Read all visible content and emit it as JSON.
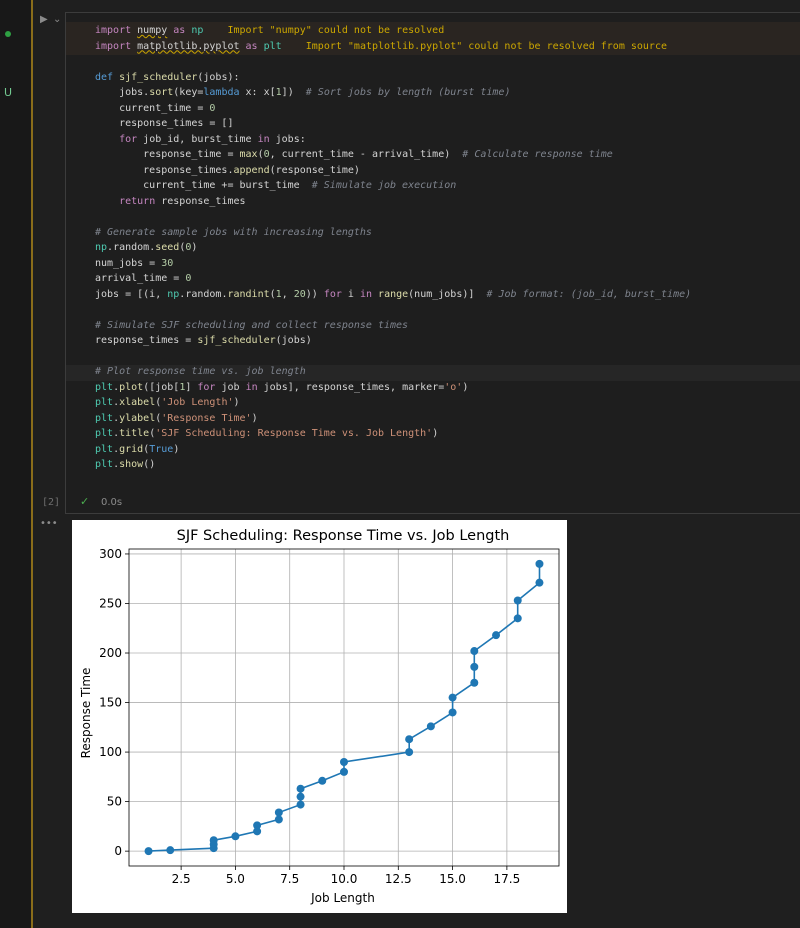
{
  "editor": {
    "exec_count": "[2]",
    "duration": "0.0s",
    "status_mark": "U",
    "more_label": "•••",
    "code_lines": [
      [
        {
          "t": "import ",
          "c": "kw"
        },
        {
          "t": "numpy",
          "c": "squig"
        },
        {
          "t": " as ",
          "c": "kw"
        },
        {
          "t": "np",
          "c": "cls"
        },
        {
          "t": "    Import \"numpy\" could not be resolved",
          "c": "warn"
        }
      ],
      [
        {
          "t": "import ",
          "c": "kw"
        },
        {
          "t": "matplotlib.pyplot",
          "c": "squig"
        },
        {
          "t": " as ",
          "c": "kw"
        },
        {
          "t": "plt",
          "c": "cls"
        },
        {
          "t": "    Import \"matplotlib.pyplot\" could not be resolved from source",
          "c": "warn"
        }
      ],
      [],
      [
        {
          "t": "def ",
          "c": "kw2"
        },
        {
          "t": "sjf_scheduler",
          "c": "fn"
        },
        {
          "t": "(jobs):",
          "c": ""
        }
      ],
      [
        {
          "t": "    jobs.",
          "c": ""
        },
        {
          "t": "sort",
          "c": "fn"
        },
        {
          "t": "(key=",
          "c": ""
        },
        {
          "t": "lambda",
          "c": "kw2"
        },
        {
          "t": " x: x[",
          "c": ""
        },
        {
          "t": "1",
          "c": "num"
        },
        {
          "t": "])  ",
          "c": ""
        },
        {
          "t": "# Sort jobs by length (burst time)",
          "c": "cm"
        }
      ],
      [
        {
          "t": "    current_time = ",
          "c": ""
        },
        {
          "t": "0",
          "c": "num"
        }
      ],
      [
        {
          "t": "    response_times = []",
          "c": ""
        }
      ],
      [
        {
          "t": "    ",
          "c": ""
        },
        {
          "t": "for",
          "c": "kw"
        },
        {
          "t": " job_id, burst_time ",
          "c": ""
        },
        {
          "t": "in",
          "c": "kw"
        },
        {
          "t": " jobs:",
          "c": ""
        }
      ],
      [
        {
          "t": "        response_time = ",
          "c": ""
        },
        {
          "t": "max",
          "c": "fn"
        },
        {
          "t": "(",
          "c": ""
        },
        {
          "t": "0",
          "c": "num"
        },
        {
          "t": ", current_time - arrival_time)  ",
          "c": ""
        },
        {
          "t": "# Calculate response time",
          "c": "cm"
        }
      ],
      [
        {
          "t": "        response_times.",
          "c": ""
        },
        {
          "t": "append",
          "c": "fn"
        },
        {
          "t": "(response_time)",
          "c": ""
        }
      ],
      [
        {
          "t": "        current_time += burst_time  ",
          "c": ""
        },
        {
          "t": "# Simulate job execution",
          "c": "cm"
        }
      ],
      [
        {
          "t": "    ",
          "c": ""
        },
        {
          "t": "return",
          "c": "kw"
        },
        {
          "t": " response_times",
          "c": ""
        }
      ],
      [],
      [
        {
          "t": "# Generate sample jobs with increasing lengths",
          "c": "cm"
        }
      ],
      [
        {
          "t": "np",
          "c": "cls"
        },
        {
          "t": ".random.",
          "c": ""
        },
        {
          "t": "seed",
          "c": "fn"
        },
        {
          "t": "(",
          "c": ""
        },
        {
          "t": "0",
          "c": "num"
        },
        {
          "t": ")",
          "c": ""
        }
      ],
      [
        {
          "t": "num_jobs = ",
          "c": ""
        },
        {
          "t": "30",
          "c": "num"
        }
      ],
      [
        {
          "t": "arrival_time = ",
          "c": ""
        },
        {
          "t": "0",
          "c": "num"
        }
      ],
      [
        {
          "t": "jobs = [(i, ",
          "c": ""
        },
        {
          "t": "np",
          "c": "cls"
        },
        {
          "t": ".random.",
          "c": ""
        },
        {
          "t": "randint",
          "c": "fn"
        },
        {
          "t": "(",
          "c": ""
        },
        {
          "t": "1",
          "c": "num"
        },
        {
          "t": ", ",
          "c": ""
        },
        {
          "t": "20",
          "c": "num"
        },
        {
          "t": ")) ",
          "c": ""
        },
        {
          "t": "for",
          "c": "kw"
        },
        {
          "t": " i ",
          "c": ""
        },
        {
          "t": "in",
          "c": "kw"
        },
        {
          "t": " ",
          "c": ""
        },
        {
          "t": "range",
          "c": "fn"
        },
        {
          "t": "(num_jobs)]  ",
          "c": ""
        },
        {
          "t": "# Job format: (job_id, burst_time)",
          "c": "cm"
        }
      ],
      [],
      [
        {
          "t": "# Simulate SJF scheduling and collect response times",
          "c": "cm"
        }
      ],
      [
        {
          "t": "response_times = ",
          "c": ""
        },
        {
          "t": "sjf_scheduler",
          "c": "fn"
        },
        {
          "t": "(jobs)",
          "c": ""
        }
      ],
      [],
      [
        {
          "t": "# Plot response time vs. job length",
          "c": "cm"
        }
      ],
      [
        {
          "t": "plt",
          "c": "cls"
        },
        {
          "t": ".",
          "c": ""
        },
        {
          "t": "plot",
          "c": "fn"
        },
        {
          "t": "([job[",
          "c": ""
        },
        {
          "t": "1",
          "c": "num"
        },
        {
          "t": "] ",
          "c": ""
        },
        {
          "t": "for",
          "c": "kw"
        },
        {
          "t": " job ",
          "c": ""
        },
        {
          "t": "in",
          "c": "kw"
        },
        {
          "t": " jobs], response_times, marker=",
          "c": ""
        },
        {
          "t": "'o'",
          "c": "str"
        },
        {
          "t": ")",
          "c": ""
        }
      ],
      [
        {
          "t": "plt",
          "c": "cls"
        },
        {
          "t": ".",
          "c": ""
        },
        {
          "t": "xlabel",
          "c": "fn"
        },
        {
          "t": "(",
          "c": ""
        },
        {
          "t": "'Job Length'",
          "c": "str"
        },
        {
          "t": ")",
          "c": ""
        }
      ],
      [
        {
          "t": "plt",
          "c": "cls"
        },
        {
          "t": ".",
          "c": ""
        },
        {
          "t": "ylabel",
          "c": "fn"
        },
        {
          "t": "(",
          "c": ""
        },
        {
          "t": "'Response Time'",
          "c": "str"
        },
        {
          "t": ")",
          "c": ""
        }
      ],
      [
        {
          "t": "plt",
          "c": "cls"
        },
        {
          "t": ".",
          "c": ""
        },
        {
          "t": "title",
          "c": "fn"
        },
        {
          "t": "(",
          "c": ""
        },
        {
          "t": "'SJF Scheduling: Response Time vs. Job Length'",
          "c": "str"
        },
        {
          "t": ")",
          "c": ""
        }
      ],
      [
        {
          "t": "plt",
          "c": "cls"
        },
        {
          "t": ".",
          "c": ""
        },
        {
          "t": "grid",
          "c": "fn"
        },
        {
          "t": "(",
          "c": ""
        },
        {
          "t": "True",
          "c": "kw2"
        },
        {
          "t": ")",
          "c": ""
        }
      ],
      [
        {
          "t": "plt",
          "c": "cls"
        },
        {
          "t": ".",
          "c": ""
        },
        {
          "t": "show",
          "c": "fn"
        },
        {
          "t": "()",
          "c": ""
        }
      ]
    ]
  },
  "colors": {
    "series": "#1f77b4",
    "grid": "#b0b0b0"
  },
  "chart_data": {
    "type": "line",
    "title": "SJF Scheduling: Response Time vs. Job Length",
    "xlabel": "Job Length",
    "ylabel": "Response Time",
    "xlim": [
      0.1,
      19.9
    ],
    "ylim": [
      -15,
      305
    ],
    "xticks": [
      2.5,
      5.0,
      7.5,
      10.0,
      12.5,
      15.0,
      17.5
    ],
    "xtick_labels": [
      "2.5",
      "5.0",
      "7.5",
      "10.0",
      "12.5",
      "15.0",
      "17.5"
    ],
    "yticks": [
      0,
      50,
      100,
      150,
      200,
      250,
      300
    ],
    "ytick_labels": [
      "0",
      "50",
      "100",
      "150",
      "200",
      "250",
      "300"
    ],
    "grid": true,
    "marker": "o",
    "x": [
      1,
      2,
      4,
      4,
      4,
      5,
      6,
      6,
      7,
      7,
      8,
      8,
      8,
      9,
      10,
      10,
      13,
      13,
      14,
      15,
      15,
      16,
      16,
      16,
      17,
      18,
      18,
      19,
      19
    ],
    "y": [
      0,
      1,
      3,
      7,
      11,
      15,
      20,
      26,
      32,
      39,
      47,
      55,
      63,
      71,
      80,
      90,
      100,
      113,
      126,
      140,
      155,
      170,
      186,
      202,
      218,
      235,
      253,
      271,
      290
    ]
  }
}
